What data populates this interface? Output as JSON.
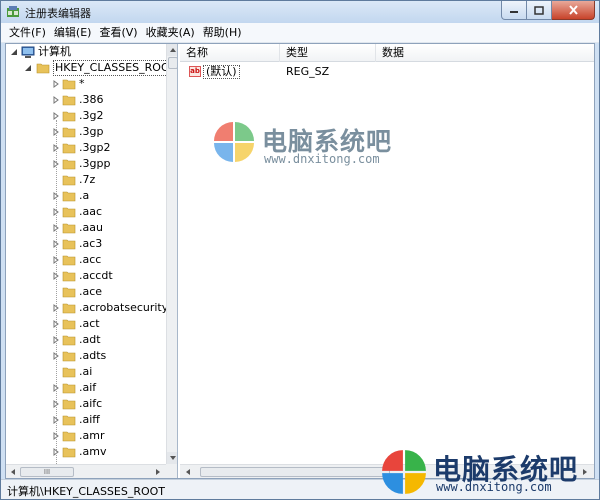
{
  "window": {
    "title": "注册表编辑器",
    "menu": [
      "文件(F)",
      "编辑(E)",
      "查看(V)",
      "收藏夹(A)",
      "帮助(H)"
    ]
  },
  "tree": {
    "root_label": "计算机",
    "selected_label": "HKEY_CLASSES_ROOT",
    "items": [
      "*",
      ".386",
      ".3g2",
      ".3gp",
      ".3gp2",
      ".3gpp",
      ".7z",
      ".a",
      ".aac",
      ".aau",
      ".ac3",
      ".acc",
      ".accdt",
      ".ace",
      ".acrobatsecurityset",
      ".act",
      ".adt",
      ".adts",
      ".ai",
      ".aif",
      ".aifc",
      ".aiff",
      ".amr",
      ".amv"
    ],
    "scroll_glyph": "III"
  },
  "list": {
    "columns": [
      "名称",
      "类型",
      "数据"
    ],
    "rows": [
      {
        "icon_text": "ab",
        "name": "(默认)",
        "type": "REG_SZ",
        "data": ""
      }
    ]
  },
  "status": {
    "path": "计算机\\HKEY_CLASSES_ROOT"
  },
  "watermark": {
    "title": "电脑系统吧",
    "url": "www.dnxitong.com"
  },
  "colors": {
    "folder": "#e8c25a",
    "logo_red": "#e8453c",
    "logo_green": "#38b34a",
    "logo_blue": "#2d8fe0",
    "logo_yellow": "#f5b800"
  }
}
